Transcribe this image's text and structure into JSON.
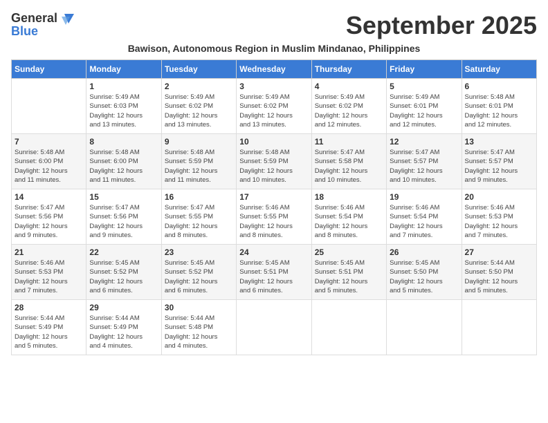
{
  "logo": {
    "general": "General",
    "blue": "Blue"
  },
  "title": "September 2025",
  "subtitle": "Bawison, Autonomous Region in Muslim Mindanao, Philippines",
  "days_of_week": [
    "Sunday",
    "Monday",
    "Tuesday",
    "Wednesday",
    "Thursday",
    "Friday",
    "Saturday"
  ],
  "weeks": [
    [
      {
        "day": "",
        "detail": ""
      },
      {
        "day": "1",
        "detail": "Sunrise: 5:49 AM\nSunset: 6:03 PM\nDaylight: 12 hours\nand 13 minutes."
      },
      {
        "day": "2",
        "detail": "Sunrise: 5:49 AM\nSunset: 6:02 PM\nDaylight: 12 hours\nand 13 minutes."
      },
      {
        "day": "3",
        "detail": "Sunrise: 5:49 AM\nSunset: 6:02 PM\nDaylight: 12 hours\nand 13 minutes."
      },
      {
        "day": "4",
        "detail": "Sunrise: 5:49 AM\nSunset: 6:02 PM\nDaylight: 12 hours\nand 12 minutes."
      },
      {
        "day": "5",
        "detail": "Sunrise: 5:49 AM\nSunset: 6:01 PM\nDaylight: 12 hours\nand 12 minutes."
      },
      {
        "day": "6",
        "detail": "Sunrise: 5:48 AM\nSunset: 6:01 PM\nDaylight: 12 hours\nand 12 minutes."
      }
    ],
    [
      {
        "day": "7",
        "detail": "Sunrise: 5:48 AM\nSunset: 6:00 PM\nDaylight: 12 hours\nand 11 minutes."
      },
      {
        "day": "8",
        "detail": "Sunrise: 5:48 AM\nSunset: 6:00 PM\nDaylight: 12 hours\nand 11 minutes."
      },
      {
        "day": "9",
        "detail": "Sunrise: 5:48 AM\nSunset: 5:59 PM\nDaylight: 12 hours\nand 11 minutes."
      },
      {
        "day": "10",
        "detail": "Sunrise: 5:48 AM\nSunset: 5:59 PM\nDaylight: 12 hours\nand 10 minutes."
      },
      {
        "day": "11",
        "detail": "Sunrise: 5:47 AM\nSunset: 5:58 PM\nDaylight: 12 hours\nand 10 minutes."
      },
      {
        "day": "12",
        "detail": "Sunrise: 5:47 AM\nSunset: 5:57 PM\nDaylight: 12 hours\nand 10 minutes."
      },
      {
        "day": "13",
        "detail": "Sunrise: 5:47 AM\nSunset: 5:57 PM\nDaylight: 12 hours\nand 9 minutes."
      }
    ],
    [
      {
        "day": "14",
        "detail": "Sunrise: 5:47 AM\nSunset: 5:56 PM\nDaylight: 12 hours\nand 9 minutes."
      },
      {
        "day": "15",
        "detail": "Sunrise: 5:47 AM\nSunset: 5:56 PM\nDaylight: 12 hours\nand 9 minutes."
      },
      {
        "day": "16",
        "detail": "Sunrise: 5:47 AM\nSunset: 5:55 PM\nDaylight: 12 hours\nand 8 minutes."
      },
      {
        "day": "17",
        "detail": "Sunrise: 5:46 AM\nSunset: 5:55 PM\nDaylight: 12 hours\nand 8 minutes."
      },
      {
        "day": "18",
        "detail": "Sunrise: 5:46 AM\nSunset: 5:54 PM\nDaylight: 12 hours\nand 8 minutes."
      },
      {
        "day": "19",
        "detail": "Sunrise: 5:46 AM\nSunset: 5:54 PM\nDaylight: 12 hours\nand 7 minutes."
      },
      {
        "day": "20",
        "detail": "Sunrise: 5:46 AM\nSunset: 5:53 PM\nDaylight: 12 hours\nand 7 minutes."
      }
    ],
    [
      {
        "day": "21",
        "detail": "Sunrise: 5:46 AM\nSunset: 5:53 PM\nDaylight: 12 hours\nand 7 minutes."
      },
      {
        "day": "22",
        "detail": "Sunrise: 5:45 AM\nSunset: 5:52 PM\nDaylight: 12 hours\nand 6 minutes."
      },
      {
        "day": "23",
        "detail": "Sunrise: 5:45 AM\nSunset: 5:52 PM\nDaylight: 12 hours\nand 6 minutes."
      },
      {
        "day": "24",
        "detail": "Sunrise: 5:45 AM\nSunset: 5:51 PM\nDaylight: 12 hours\nand 6 minutes."
      },
      {
        "day": "25",
        "detail": "Sunrise: 5:45 AM\nSunset: 5:51 PM\nDaylight: 12 hours\nand 5 minutes."
      },
      {
        "day": "26",
        "detail": "Sunrise: 5:45 AM\nSunset: 5:50 PM\nDaylight: 12 hours\nand 5 minutes."
      },
      {
        "day": "27",
        "detail": "Sunrise: 5:44 AM\nSunset: 5:50 PM\nDaylight: 12 hours\nand 5 minutes."
      }
    ],
    [
      {
        "day": "28",
        "detail": "Sunrise: 5:44 AM\nSunset: 5:49 PM\nDaylight: 12 hours\nand 5 minutes."
      },
      {
        "day": "29",
        "detail": "Sunrise: 5:44 AM\nSunset: 5:49 PM\nDaylight: 12 hours\nand 4 minutes."
      },
      {
        "day": "30",
        "detail": "Sunrise: 5:44 AM\nSunset: 5:48 PM\nDaylight: 12 hours\nand 4 minutes."
      },
      {
        "day": "",
        "detail": ""
      },
      {
        "day": "",
        "detail": ""
      },
      {
        "day": "",
        "detail": ""
      },
      {
        "day": "",
        "detail": ""
      }
    ]
  ]
}
